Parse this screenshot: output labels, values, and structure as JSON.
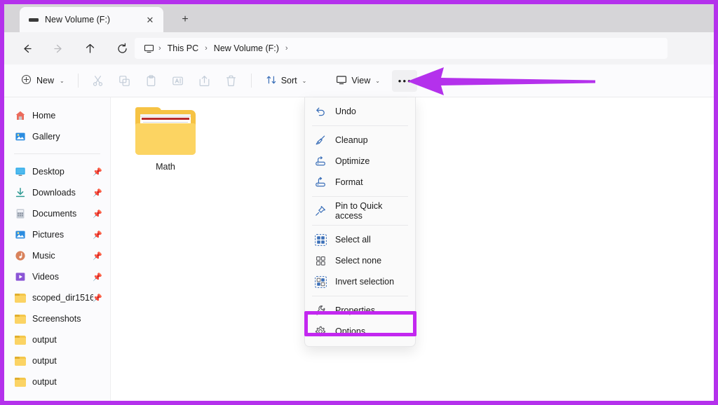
{
  "window": {
    "annotation_border_color": "#b431ec",
    "highlight_color": "#c328f0",
    "arrow_color": "#b431ec"
  },
  "tabs": {
    "active_tab_label": "New Volume (F:)",
    "drive_icon": "drive-icon",
    "close_icon": "✕",
    "new_tab_icon": "+"
  },
  "nav": {
    "back_icon": "←",
    "forward_icon": "→",
    "up_icon": "↑",
    "refresh_icon": "↻"
  },
  "address": {
    "pc_icon": "this-pc-icon",
    "separator": "›",
    "crumbs": [
      "This PC",
      "New Volume (F:)"
    ]
  },
  "toolbar": {
    "new_label": "New",
    "new_icon": "⊕",
    "chevron": "⌄",
    "icon_buttons": [
      {
        "name": "cut",
        "glyph": "cut-icon"
      },
      {
        "name": "copy",
        "glyph": "copy-icon"
      },
      {
        "name": "paste",
        "glyph": "paste-icon"
      },
      {
        "name": "rename",
        "glyph": "rename-icon"
      },
      {
        "name": "share",
        "glyph": "share-icon"
      },
      {
        "name": "delete",
        "glyph": "delete-icon"
      }
    ],
    "sort_label": "Sort",
    "sort_icon": "sort-icon",
    "view_label": "View",
    "view_icon": "view-icon",
    "more_label": "•••"
  },
  "sidebar": {
    "top_items": [
      {
        "label": "Home",
        "icon": "home-icon",
        "pinned": false
      },
      {
        "label": "Gallery",
        "icon": "gallery-icon",
        "pinned": false
      }
    ],
    "items": [
      {
        "label": "Desktop",
        "icon": "desktop-icon",
        "pinned": true
      },
      {
        "label": "Downloads",
        "icon": "downloads-icon",
        "pinned": true
      },
      {
        "label": "Documents",
        "icon": "documents-icon",
        "pinned": true
      },
      {
        "label": "Pictures",
        "icon": "pictures-icon",
        "pinned": true
      },
      {
        "label": "Music",
        "icon": "music-icon",
        "pinned": true
      },
      {
        "label": "Videos",
        "icon": "videos-icon",
        "pinned": true
      },
      {
        "label": "scoped_dir1516(",
        "icon": "folder-icon",
        "pinned": true
      },
      {
        "label": "Screenshots",
        "icon": "folder-icon",
        "pinned": false
      },
      {
        "label": "output",
        "icon": "folder-icon",
        "pinned": false
      },
      {
        "label": "output",
        "icon": "folder-icon",
        "pinned": false
      },
      {
        "label": "output",
        "icon": "folder-icon",
        "pinned": false
      }
    ]
  },
  "content": {
    "files": [
      {
        "label": "Math",
        "icon": "folder-with-document-icon"
      }
    ]
  },
  "context_menu": {
    "groups": [
      [
        {
          "label": "Undo",
          "icon": "undo-icon"
        }
      ],
      [
        {
          "label": "Cleanup",
          "icon": "cleanup-icon"
        },
        {
          "label": "Optimize",
          "icon": "optimize-icon"
        },
        {
          "label": "Format",
          "icon": "format-icon"
        }
      ],
      [
        {
          "label": "Pin to Quick access",
          "icon": "pin-icon"
        }
      ],
      [
        {
          "label": "Select all",
          "icon": "select-all-icon"
        },
        {
          "label": "Select none",
          "icon": "select-none-icon"
        },
        {
          "label": "Invert selection",
          "icon": "invert-selection-icon"
        }
      ],
      [
        {
          "label": "Properties",
          "icon": "properties-icon"
        },
        {
          "label": "Options",
          "icon": "options-gear-icon"
        }
      ]
    ],
    "highlighted_item": "Options"
  }
}
